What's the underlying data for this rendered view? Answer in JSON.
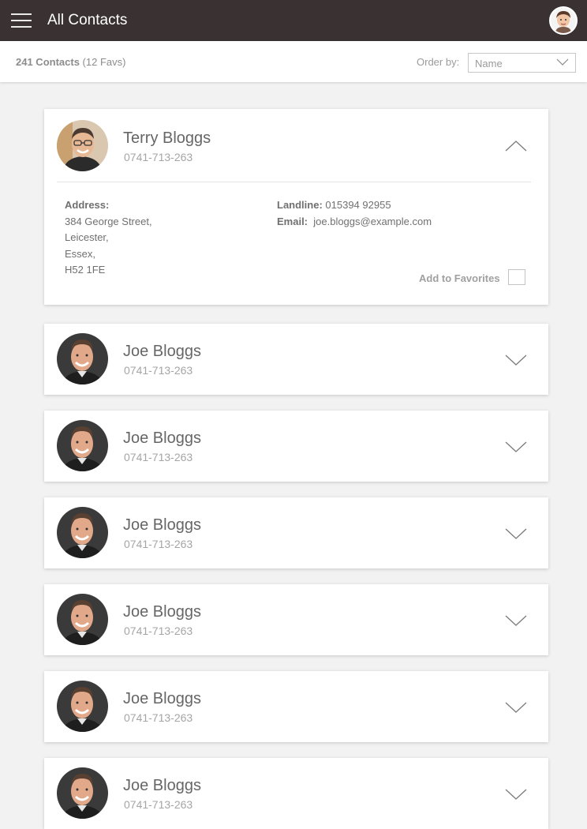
{
  "appbar": {
    "title": "All Contacts"
  },
  "subheader": {
    "count_bold": "241 Contacts",
    "count_favs": "(12 Favs)",
    "order_label": "Order by:",
    "order_value": "Name"
  },
  "expanded": {
    "name": "Terry Bloggs",
    "phone": "0741-713-263",
    "address_label": "Address:",
    "address_lines": [
      "384 George Street,",
      "Leicester,",
      "Essex,",
      "H52 1FE"
    ],
    "landline_label": "Landline:",
    "landline_value": "015394 92955",
    "email_label": "Email:",
    "email_value": "joe.bloggs@example.com",
    "favorites_label": "Add to Favorites"
  },
  "contacts": [
    {
      "name": "Joe Bloggs",
      "phone": "0741-713-263"
    },
    {
      "name": "Joe Bloggs",
      "phone": "0741-713-263"
    },
    {
      "name": "Joe Bloggs",
      "phone": "0741-713-263"
    },
    {
      "name": "Joe Bloggs",
      "phone": "0741-713-263"
    },
    {
      "name": "Joe Bloggs",
      "phone": "0741-713-263"
    },
    {
      "name": "Joe Bloggs",
      "phone": "0741-713-263"
    }
  ],
  "icons": {
    "menu": "hamburger-menu-icon",
    "profile": "user-avatar-icon",
    "select": "chevron-down-icon",
    "collapse": "chevron-up-icon",
    "expand": "chevron-down-icon"
  },
  "colors": {
    "appbar": "#3a3132",
    "background": "#f2f2f2",
    "card": "#ffffff"
  }
}
